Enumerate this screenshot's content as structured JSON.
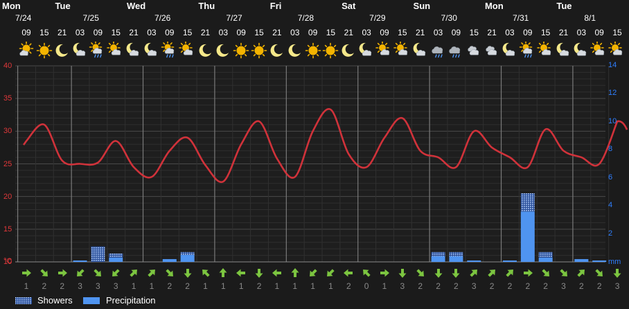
{
  "days": [
    {
      "name": "Mon",
      "date": "7/24"
    },
    {
      "name": "Tue",
      "date": "7/25"
    },
    {
      "name": "Wed",
      "date": "7/26"
    },
    {
      "name": "Thu",
      "date": "7/27"
    },
    {
      "name": "Fri",
      "date": "7/28"
    },
    {
      "name": "Sat",
      "date": "7/29"
    },
    {
      "name": "Sun",
      "date": "7/30"
    },
    {
      "name": "Mon",
      "date": "7/31"
    },
    {
      "name": "Tue",
      "date": "8/1"
    }
  ],
  "hours": [
    "09",
    "15",
    "21",
    "03",
    "09",
    "15",
    "21",
    "03",
    "09",
    "15",
    "21",
    "03",
    "09",
    "15",
    "21",
    "03",
    "09",
    "15",
    "21",
    "03",
    "09",
    "15",
    "21",
    "03",
    "09",
    "15",
    "21",
    "03",
    "09",
    "15",
    "21",
    "03",
    "09",
    "15"
  ],
  "icons": [
    "partly-sunny-icon",
    "sun-icon",
    "moon-icon",
    "moon-cloud-icon",
    "sun-cloud-rain-icon",
    "sun-cloud-icon",
    "moon-cloud-icon",
    "moon-cloud-icon",
    "sun-cloud-rain-icon",
    "sun-cloud-icon",
    "moon-icon",
    "moon-icon",
    "sun-icon",
    "sun-icon",
    "moon-icon",
    "moon-icon",
    "sun-icon",
    "sun-icon",
    "moon-icon",
    "moon-cloud-icon",
    "sun-cloud-icon",
    "sun-cloud-icon",
    "moon-cloud-icon",
    "cloud-rain-icon",
    "cloud-rain-icon",
    "cloud-icon",
    "cloud-icon",
    "moon-cloud-icon",
    "sun-cloud-rain-icon",
    "sun-cloud-icon",
    "moon-cloud-icon",
    "moon-cloud-icon",
    "sun-cloud-icon",
    "sun-cloud-icon"
  ],
  "wind_directions": [
    "E",
    "SE",
    "E",
    "SW",
    "SE",
    "SW",
    "NE",
    "NE",
    "SE",
    "S",
    "NW",
    "N",
    "W",
    "S",
    "W",
    "N",
    "SW",
    "SW",
    "W",
    "NW",
    "E",
    "S",
    "SE",
    "S",
    "S",
    "NE",
    "NE",
    "NE",
    "E",
    "SE",
    "SE",
    "NE",
    "SE",
    "S"
  ],
  "wind_speeds": [
    "1",
    "2",
    "2",
    "3",
    "3",
    "3",
    "1",
    "1",
    "2",
    "2",
    "1",
    "1",
    "1",
    "2",
    "1",
    "1",
    "1",
    "1",
    "2",
    "0",
    "1",
    "3",
    "2",
    "2",
    "2",
    "3",
    "2",
    "2",
    "2",
    "2",
    "3",
    "2",
    "2",
    "3"
  ],
  "axes": {
    "temp_ticks": [
      "40",
      "35",
      "30",
      "25",
      "20",
      "15",
      "10",
      "°C"
    ],
    "precip_ticks": [
      "14",
      "12",
      "10",
      "8",
      "6",
      "4",
      "2",
      "mm"
    ]
  },
  "legend": {
    "showers": "Showers",
    "precipitation": "Precipitation"
  },
  "colors": {
    "temperature": "#d0323a",
    "precipitation": "#4f94f0",
    "showers": "#9fc3f7",
    "grid": "#3c3c3c",
    "day_divider": "#7a7a7a",
    "wind_arrow": "#7cc540",
    "sun": "#f4b400",
    "moon": "#f5e88a",
    "cloud": "#d7dbe0"
  },
  "chart_data": {
    "type": "line",
    "x": [
      "7/24 09",
      "7/24 15",
      "7/24 21",
      "7/25 03",
      "7/25 09",
      "7/25 15",
      "7/25 21",
      "7/26 03",
      "7/26 09",
      "7/26 15",
      "7/26 21",
      "7/27 03",
      "7/27 09",
      "7/27 15",
      "7/27 21",
      "7/28 03",
      "7/28 09",
      "7/28 15",
      "7/28 21",
      "7/29 03",
      "7/29 09",
      "7/29 15",
      "7/29 21",
      "7/30 03",
      "7/30 09",
      "7/30 15",
      "7/30 21",
      "7/31 03",
      "7/31 09",
      "7/31 15",
      "7/31 21",
      "8/1 03",
      "8/1 09",
      "8/1 15"
    ],
    "series": [
      {
        "values": [
          28.5,
          31,
          25.5,
          25,
          25.2,
          28.5,
          24.5,
          23,
          27,
          29,
          24.8,
          22.3,
          28,
          31.5,
          25.8,
          23,
          30,
          33.3,
          26.5,
          24.5,
          29,
          32,
          27,
          26,
          24.5,
          30,
          27.5,
          26,
          24.5,
          30.3,
          27,
          26,
          25,
          31.5
        ],
        "axis": "temperature"
      },
      {
        "values": [
          0,
          0,
          0,
          0.1,
          1.1,
          0.6,
          0,
          0,
          0.2,
          0.7,
          0,
          0,
          0,
          0,
          0,
          0,
          0,
          0,
          0,
          0,
          0,
          0,
          0,
          0.7,
          0.7,
          0.1,
          0,
          0.1,
          4.9,
          0.7,
          0,
          0.2,
          0.1,
          0
        ],
        "axis": "precipitation",
        "mark": "bar"
      },
      {
        "values": [
          0,
          0,
          0,
          0,
          1.1,
          0.3,
          0,
          0,
          0,
          0.2,
          0,
          0,
          0,
          0,
          0,
          0,
          0,
          0,
          0,
          0,
          0,
          0,
          0,
          0.3,
          0.3,
          0,
          0,
          0,
          1.3,
          0.4,
          0,
          0,
          0,
          0
        ],
        "axis": "precipitation",
        "mark": "bar"
      }
    ],
    "temperature_ylim": [
      10,
      40
    ],
    "precipitation_ylim": [
      0,
      14
    ],
    "grid": true
  }
}
